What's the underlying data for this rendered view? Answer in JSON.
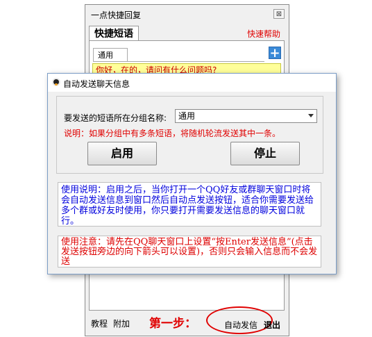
{
  "back_window": {
    "title": "一点快捷回复",
    "close_glyph": "⊠",
    "tab_quick_phrases": "快捷短语",
    "help_link": "快速帮助",
    "tab_general": "通用",
    "add_glyph": "+",
    "phrase_item": "你好，在的，请问有什么问题吗?",
    "bottom": {
      "tutorial": "教程",
      "addon": "附加",
      "step_label": "第一步：",
      "auto_send": "自动发信",
      "exit": "退出"
    }
  },
  "dialog": {
    "title": "自动发送聊天信息",
    "group_label": "要发送的短语所在分组名称:",
    "group_selected": "通用",
    "note": "说明：如果分组中有多条短语，将随机轮流发送其中一条。",
    "start_button": "启用",
    "stop_button": "停止",
    "usage_text": "使用说明：启用之后，当你打开一个QQ好友或群聊天窗口时将会自动发送信息到窗口然后自动点发送按钮，适合你需要发送给多个群或好友时使用，你只要打开需要发送信息的聊天窗口就行。",
    "warning_text": "使用注意：请先在QQ聊天窗口上设置“按Enter发送信息”(点击发送按钮旁边的向下箭头可以设置)，否则只会输入信息而不会发送"
  },
  "colors": {
    "accent_red": "#e00000",
    "info_blue": "#0000dd",
    "phrase_highlight": "#ffff99",
    "add_button": "#3a8ad8"
  }
}
